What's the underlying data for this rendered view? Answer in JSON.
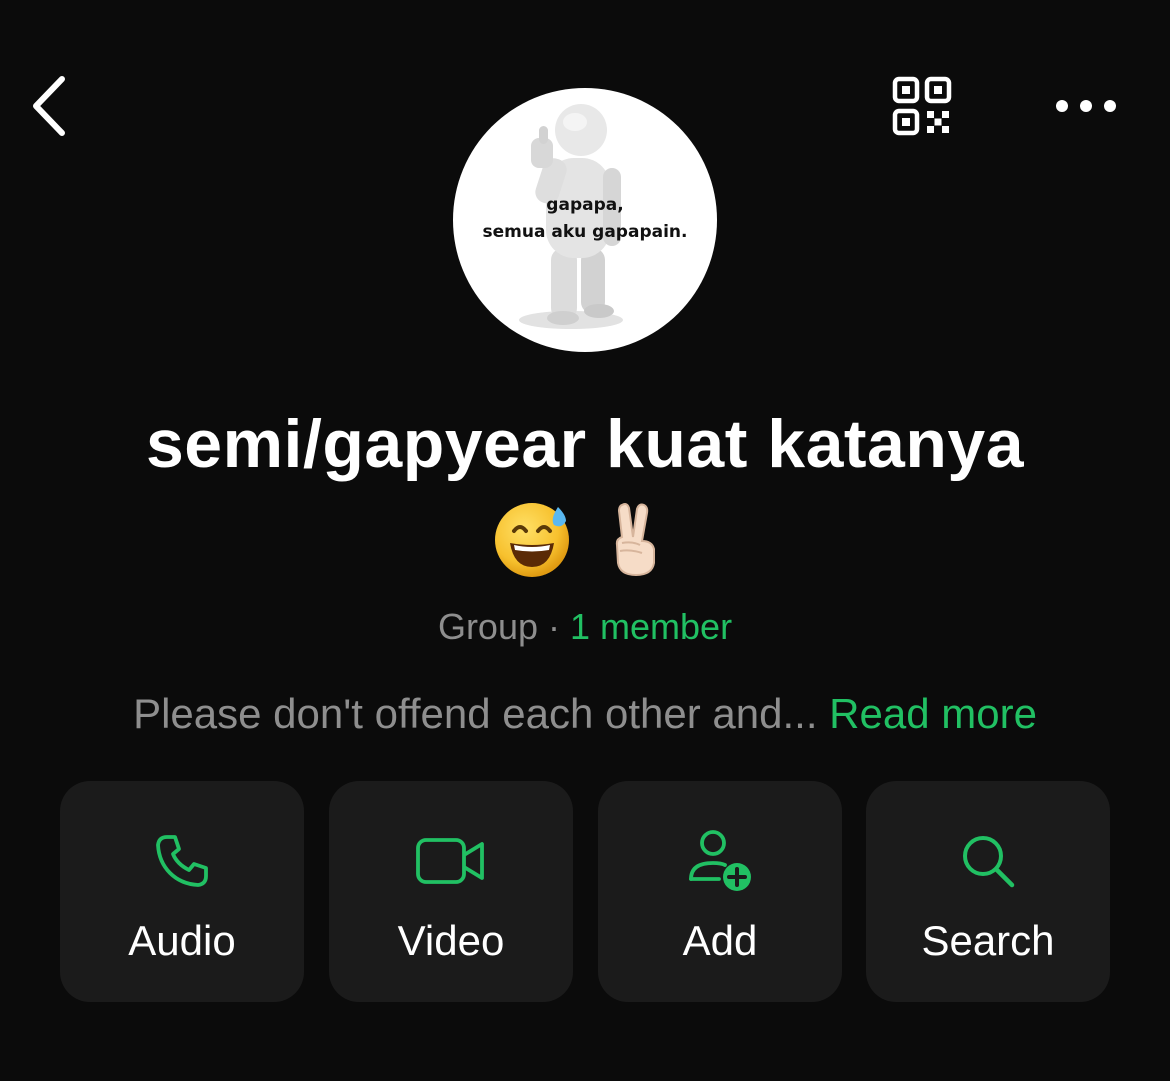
{
  "header": {
    "back_icon": "chevron-left-icon",
    "qr_icon": "qr-code-icon",
    "more_icon": "more-horizontal-icon"
  },
  "avatar": {
    "caption_line1": "gapapa,",
    "caption_line2": "semua aku gapapain."
  },
  "group": {
    "name": "semi/gapyear kuat katanya",
    "emojis": [
      "grinning-face-with-sweat",
      "victory-hand-light-skin-tone"
    ],
    "type": "Group",
    "separator": " · ",
    "members": "1 member",
    "description": "Please don't offend each other and...",
    "read_more": "Read more"
  },
  "actions": [
    {
      "label": "Audio",
      "icon": "phone-icon"
    },
    {
      "label": "Video",
      "icon": "video-camera-icon"
    },
    {
      "label": "Add",
      "icon": "add-user-icon"
    },
    {
      "label": "Search",
      "icon": "search-icon"
    }
  ],
  "colors": {
    "background": "#0b0b0b",
    "accent": "#21c063",
    "muted_text": "#8e8e8e",
    "card_background": "#1b1b1b",
    "text": "#ffffff"
  }
}
